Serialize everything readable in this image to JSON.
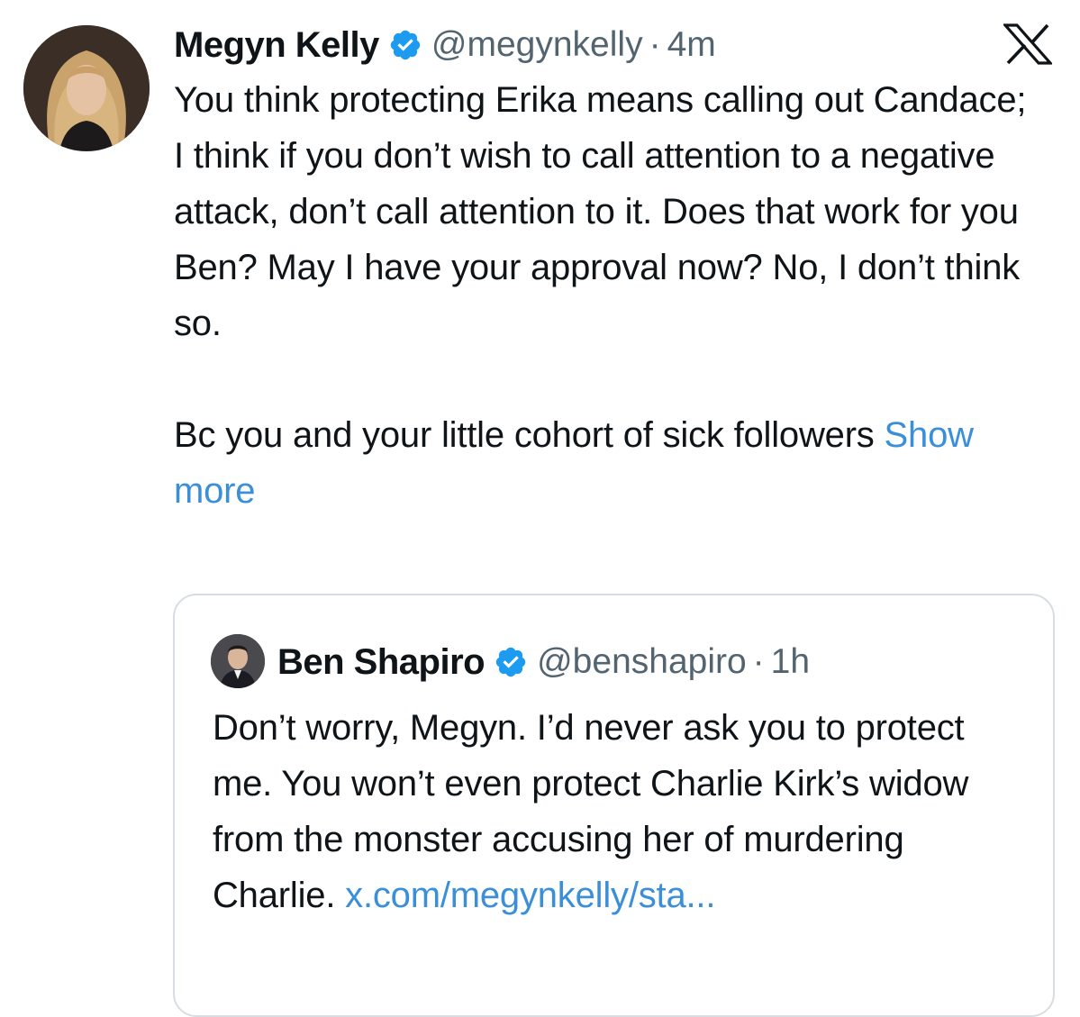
{
  "tweet": {
    "author_name": "Megyn Kelly",
    "handle": "@megynkelly",
    "separator": "·",
    "time": "4m",
    "verified_color": "#1d9bf0",
    "paragraph1": "You think protecting Erika means calling out Candace; I think if you don’t wish to call attention to a negative attack, don’t call attention to it. Does that work for you Ben? May I have your approval now? No, I don’t think so.",
    "paragraph2": "Bc you and your little cohort of sick followers",
    "show_more": "Show more"
  },
  "quoted": {
    "author_name": "Ben Shapiro",
    "handle": "@benshapiro",
    "separator": "·",
    "time": "1h",
    "text": "Don’t worry, Megyn. I’d never ask you to protect me. You won’t even protect Charlie Kirk’s widow from the monster accusing her of murdering Charlie.",
    "link": "x.com/​megynkelly/sta..."
  },
  "icons": {
    "verified": "verified-badge-icon",
    "platform": "x-logo-icon"
  },
  "colors": {
    "link": "#3b8fd9",
    "secondary_text": "#536471",
    "border": "#d7dde2"
  }
}
